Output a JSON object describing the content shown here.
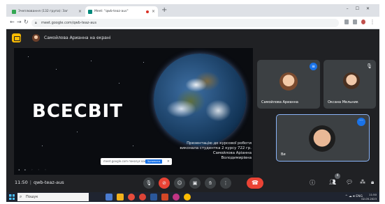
{
  "browser": {
    "tabs": [
      {
        "label": "Зчеплювання (132 група): Заг",
        "active": false
      },
      {
        "label": "Meet: \"qwb-teaz-aus\"",
        "active": true
      }
    ],
    "new_tab": "+",
    "url": "meet.google.com/qwb-teaz-aus"
  },
  "meet": {
    "presenting_banner": "Самойлова Арианна на екрані",
    "slide": {
      "title": "ВСЕСВІТ",
      "caption_lines": [
        "Презентацію до курсової роботи",
        "виконала студентка 2 курсу 722 гр.",
        "Самойлова Аріанна",
        "Володимирівна"
      ],
      "notice_text": "meet.google.com показує ваш екран",
      "notice_button": "Зупинити"
    },
    "participants": [
      {
        "name": "Самойлова Арианна",
        "status": "speaking"
      },
      {
        "name": "Оксана Мельник",
        "status": "muted"
      },
      {
        "name": "Ви",
        "status": "self"
      }
    ],
    "meeting_time": "11:50",
    "meeting_code": "qwb-teaz-aus",
    "participant_count": "4"
  },
  "taskbar": {
    "search_placeholder": "Пошук",
    "language": "ENG",
    "time": "11:50",
    "date": "02.05.2023"
  },
  "colors": {
    "meet_bg": "#202124",
    "accent_blue": "#1a73e8",
    "hangup_red": "#ea4335",
    "present_yellow": "#fbbc04"
  }
}
